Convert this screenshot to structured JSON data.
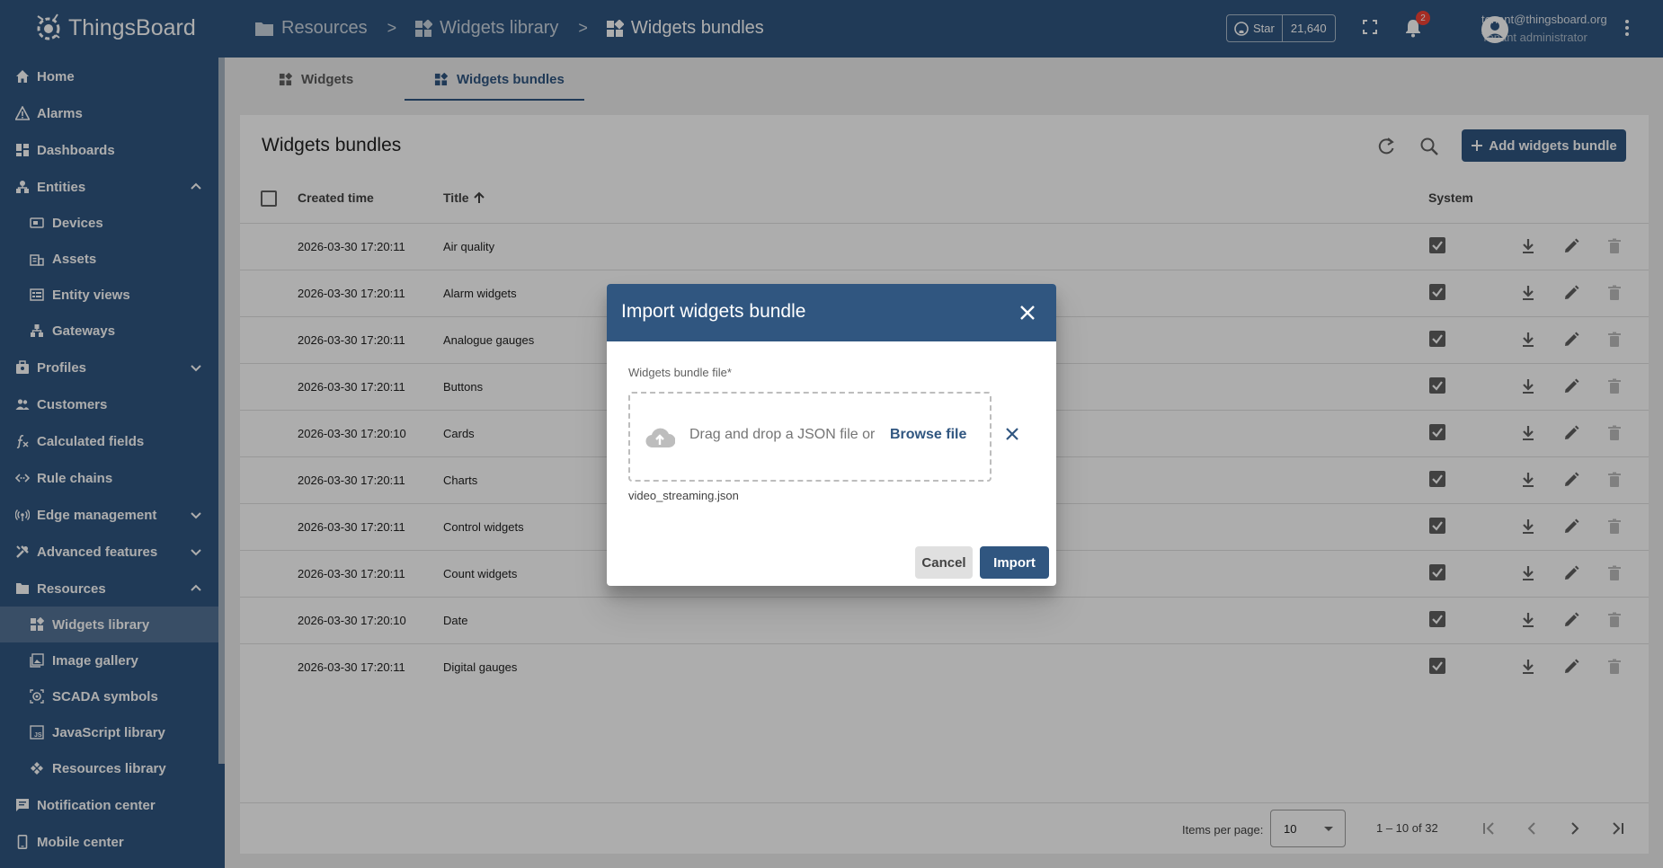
{
  "app": {
    "name": "ThingsBoard",
    "brand_color": "#305680"
  },
  "breadcrumb": [
    {
      "label": "Resources",
      "icon": "folder-icon"
    },
    {
      "label": "Widgets library",
      "icon": "widgets-icon"
    },
    {
      "label": "Widgets bundles",
      "icon": "widgets-icon"
    }
  ],
  "breadcrumb_separator": ">",
  "header": {
    "github_star_label": "Star",
    "github_star_count": "21,640",
    "notification_count": "2",
    "user_email": "tenant@thingsboard.org",
    "user_role": "Tenant administrator"
  },
  "sidebar": {
    "items": [
      {
        "label": "Home",
        "icon": "home-icon"
      },
      {
        "label": "Alarms",
        "icon": "alarm-icon"
      },
      {
        "label": "Dashboards",
        "icon": "dashboard-icon"
      },
      {
        "label": "Entities",
        "icon": "entities-icon",
        "expanded": true
      },
      {
        "label": "Devices",
        "icon": "device-icon",
        "sub": true
      },
      {
        "label": "Assets",
        "icon": "asset-icon",
        "sub": true
      },
      {
        "label": "Entity views",
        "icon": "entity-view-icon",
        "sub": true
      },
      {
        "label": "Gateways",
        "icon": "gateway-icon",
        "sub": true
      },
      {
        "label": "Profiles",
        "icon": "profile-icon",
        "expanded": false
      },
      {
        "label": "Customers",
        "icon": "customers-icon"
      },
      {
        "label": "Calculated fields",
        "icon": "function-icon"
      },
      {
        "label": "Rule chains",
        "icon": "rule-chain-icon"
      },
      {
        "label": "Edge management",
        "icon": "edge-icon",
        "expanded": false
      },
      {
        "label": "Advanced features",
        "icon": "tools-icon",
        "expanded": false
      },
      {
        "label": "Resources",
        "icon": "folder-icon",
        "expanded": true
      },
      {
        "label": "Widgets library",
        "icon": "widgets-icon",
        "sub": true,
        "active": true
      },
      {
        "label": "Image gallery",
        "icon": "image-icon",
        "sub": true
      },
      {
        "label": "SCADA symbols",
        "icon": "scada-icon",
        "sub": true
      },
      {
        "label": "JavaScript library",
        "icon": "javascript-icon",
        "sub": true
      },
      {
        "label": "Resources library",
        "icon": "resources-icon",
        "sub": true
      },
      {
        "label": "Notification center",
        "icon": "notification-icon"
      },
      {
        "label": "Mobile center",
        "icon": "mobile-icon"
      }
    ]
  },
  "tabs": [
    {
      "label": "Widgets",
      "active": false
    },
    {
      "label": "Widgets bundles",
      "active": true
    }
  ],
  "table": {
    "title": "Widgets bundles",
    "add_button_label": "Add widgets bundle",
    "columns": {
      "created_time": "Created time",
      "title": "Title",
      "system": "System"
    },
    "rows": [
      {
        "created": "2026-03-30 17:20:11",
        "title": "Air quality",
        "system": true
      },
      {
        "created": "2026-03-30 17:20:11",
        "title": "Alarm widgets",
        "system": true
      },
      {
        "created": "2026-03-30 17:20:11",
        "title": "Analogue gauges",
        "system": true
      },
      {
        "created": "2026-03-30 17:20:11",
        "title": "Buttons",
        "system": true
      },
      {
        "created": "2026-03-30 17:20:10",
        "title": "Cards",
        "system": true
      },
      {
        "created": "2026-03-30 17:20:11",
        "title": "Charts",
        "system": true
      },
      {
        "created": "2026-03-30 17:20:11",
        "title": "Control widgets",
        "system": true
      },
      {
        "created": "2026-03-30 17:20:11",
        "title": "Count widgets",
        "system": true
      },
      {
        "created": "2026-03-30 17:20:10",
        "title": "Date",
        "system": true
      },
      {
        "created": "2026-03-30 17:20:11",
        "title": "Digital gauges",
        "system": true
      }
    ]
  },
  "pagination": {
    "items_per_page_label": "Items per page:",
    "items_per_page": "10",
    "range": "1 – 10 of 32"
  },
  "dialog": {
    "title": "Import widgets bundle",
    "field_label": "Widgets bundle file*",
    "dropzone_text": "Drag and drop a JSON file or",
    "browse_label": "Browse file",
    "file_name": "video_streaming.json",
    "cancel_label": "Cancel",
    "import_label": "Import"
  }
}
